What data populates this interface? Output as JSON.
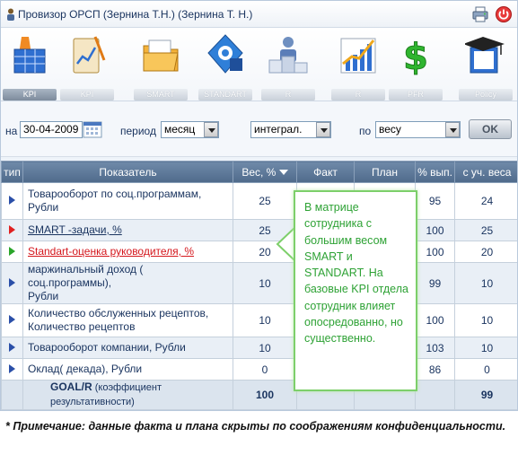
{
  "window": {
    "title": "Провизор ОРСП (Зернина Т.Н.)  (Зернина Т. Н.)",
    "right_icons": [
      "printer-icon",
      "power-icon"
    ]
  },
  "toolbar": {
    "items": [
      {
        "label": "KPI",
        "icon": "kpi-table-icon",
        "active": true
      },
      {
        "label": "KPI",
        "icon": "kpi-chart-icon",
        "active": false
      },
      {
        "label": "SMART",
        "icon": "smart-folder-icon",
        "active": false
      },
      {
        "label": "STANDART",
        "icon": "goal-standart-icon",
        "active": false
      },
      {
        "label": "R",
        "icon": "ranking-icon",
        "active": false
      },
      {
        "label": "R",
        "icon": "growth-chart-icon",
        "active": false
      },
      {
        "label": "PFR",
        "icon": "dollar-icon",
        "active": false
      },
      {
        "label": "Policy",
        "icon": "policy-book-icon",
        "active": false
      }
    ]
  },
  "filters": {
    "on_label": "на",
    "date": "30-04-2009",
    "period_label": "период",
    "period_value": "месяц",
    "mode_value": "интеграл.",
    "by_label": "по",
    "by_value": "весу",
    "ok_label": "OK"
  },
  "table": {
    "columns": [
      "тип",
      "Показатель",
      "Вес, %",
      "Факт",
      "План",
      "% вып.",
      "с уч. веса"
    ],
    "sort_column": "Вес, %",
    "rows": [
      {
        "type_color": "#2b4fa8",
        "name_line1": "Товарооборот по соц.программам,",
        "name_line2": "Рубли",
        "style": "plain",
        "weight": "25",
        "fact": "",
        "plan": "",
        "pct": "95",
        "weighted": "24"
      },
      {
        "type_color": "#e02020",
        "name_line1": "SMART -задачи, %",
        "name_line2": "",
        "style": "link-blue",
        "weight": "25",
        "fact": "",
        "plan": "",
        "pct": "100",
        "weighted": "25"
      },
      {
        "type_color": "#2aa52a",
        "name_line1": "Standart-оценка руководителя, %",
        "name_line2": "",
        "style": "link-red",
        "weight": "20",
        "fact": "",
        "plan": "",
        "pct": "100",
        "weighted": "20"
      },
      {
        "type_color": "#2b4fa8",
        "name_line1": "маржинальный доход ( соц.программы),",
        "name_line2": "Рубли",
        "style": "plain",
        "weight": "10",
        "fact": "",
        "plan": "",
        "pct": "99",
        "weighted": "10"
      },
      {
        "type_color": "#2b4fa8",
        "name_line1": "Количество обслуженных рецептов,",
        "name_line2": "Количество рецептов",
        "style": "plain",
        "weight": "10",
        "fact": "",
        "plan": "",
        "pct": "100",
        "weighted": "10"
      },
      {
        "type_color": "#2b4fa8",
        "name_line1": "Товарооборот компании, Рубли",
        "name_line2": "",
        "style": "plain",
        "weight": "10",
        "fact": "",
        "plan": "",
        "pct": "103",
        "weighted": "10"
      },
      {
        "type_color": "#2b4fa8",
        "name_line1": "Оклад( декада), Рубли",
        "name_line2": "",
        "style": "plain",
        "weight": "0",
        "fact": "",
        "plan": "",
        "pct": "86",
        "weighted": "0"
      }
    ],
    "total": {
      "goal": "GOAL/R",
      "goal_note": "(коэффициент результативности)",
      "weight": "100",
      "weighted": "99"
    }
  },
  "callout": {
    "text": "В матрице сотрудника с большим весом SMART и STANDART. На базовые KPI отдела сотрудник влияет опосредованно, но существенно."
  },
  "footnote": {
    "text": "* Примечание: данные факта и плана скрыты по соображениям конфиденциальности."
  },
  "colors": {
    "accent_green": "#2ea235",
    "header_blue": "#5a7596",
    "link_red": "#d4161c"
  }
}
